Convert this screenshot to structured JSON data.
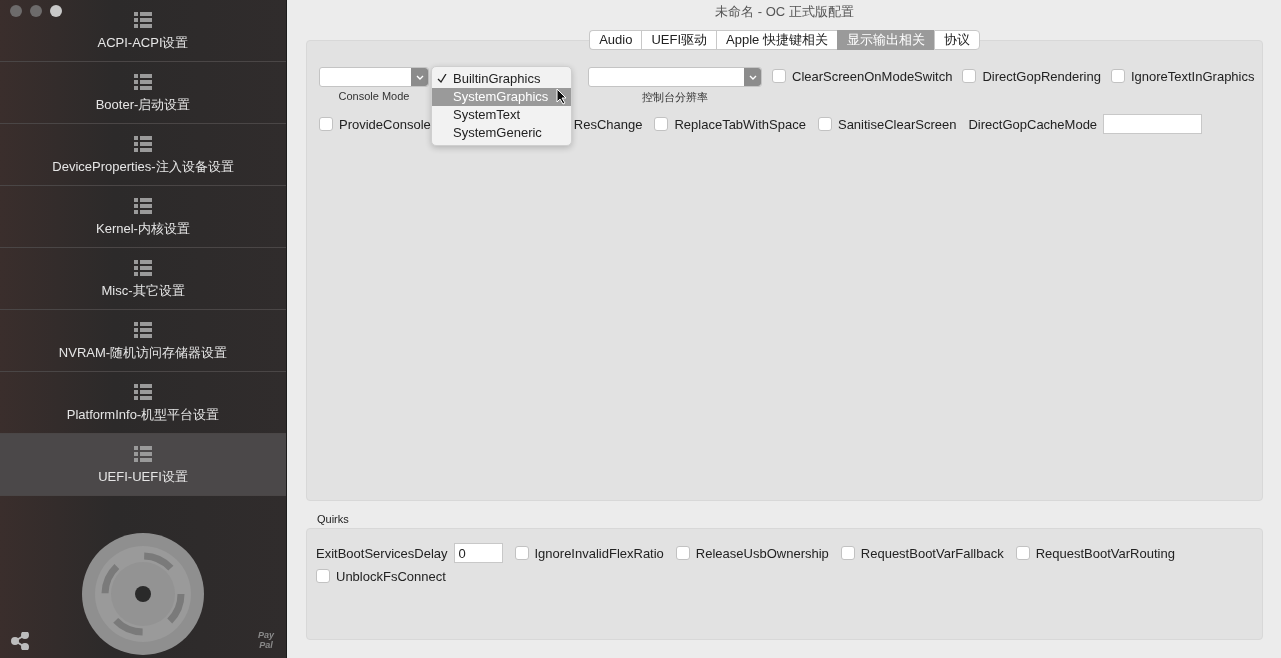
{
  "window": {
    "title": "未命名 - OC 正式版配置"
  },
  "sidebar": {
    "items": [
      {
        "label": "ACPI-ACPI设置",
        "selected": false
      },
      {
        "label": "Booter-启动设置",
        "selected": false
      },
      {
        "label": "DeviceProperties-注入设备设置",
        "selected": false
      },
      {
        "label": "Kernel-内核设置",
        "selected": false
      },
      {
        "label": "Misc-其它设置",
        "selected": false
      },
      {
        "label": "NVRAM-随机访问存储器设置",
        "selected": false
      },
      {
        "label": "PlatformInfo-机型平台设置",
        "selected": false
      },
      {
        "label": "UEFI-UEFI设置",
        "selected": true
      }
    ],
    "donate": "Pay Pal"
  },
  "tabs": [
    {
      "label": "Audio",
      "selected": false
    },
    {
      "label": "UEFI驱动",
      "selected": false
    },
    {
      "label": "Apple 快捷键相关",
      "selected": false
    },
    {
      "label": "显示输出相关",
      "selected": true
    },
    {
      "label": "协议",
      "selected": false
    }
  ],
  "output": {
    "console_mode": {
      "caption": "Console Mode"
    },
    "menu": [
      {
        "label": "BuiltinGraphics",
        "checked": true,
        "selected": false
      },
      {
        "label": "SystemGraphics",
        "checked": false,
        "selected": true
      },
      {
        "label": "SystemText",
        "checked": false,
        "selected": false
      },
      {
        "label": "SystemGeneric",
        "checked": false,
        "selected": false
      }
    ],
    "resolution": {
      "caption": "控制台分辨率"
    },
    "row1": [
      {
        "label": "ClearScreenOnModeSwitch",
        "checked": false
      },
      {
        "label": "DirectGopRendering",
        "checked": false
      },
      {
        "label": "IgnoreTextInGraphics",
        "checked": false
      }
    ],
    "row2": [
      {
        "kind": "checkbox",
        "label": "ProvideConsole",
        "checked": false
      },
      {
        "kind": "fragment",
        "label": "ResChange"
      },
      {
        "kind": "checkbox",
        "label": "ReplaceTabWithSpace",
        "checked": false
      },
      {
        "kind": "checkbox",
        "label": "SanitiseClearScreen",
        "checked": false
      },
      {
        "kind": "field",
        "label": "DirectGopCacheMode"
      }
    ]
  },
  "quirks": {
    "title": "Quirks",
    "items": [
      {
        "kind": "field",
        "label": "ExitBootServicesDelay",
        "value": "0"
      },
      {
        "kind": "checkbox",
        "label": "IgnoreInvalidFlexRatio",
        "checked": false
      },
      {
        "kind": "checkbox",
        "label": "ReleaseUsbOwnership",
        "checked": false
      },
      {
        "kind": "checkbox",
        "label": "RequestBootVarFallback",
        "checked": false
      },
      {
        "kind": "checkbox",
        "label": "RequestBootVarRouting",
        "checked": false
      },
      {
        "kind": "checkbox",
        "label": "UnblockFsConnect",
        "checked": false
      }
    ]
  }
}
